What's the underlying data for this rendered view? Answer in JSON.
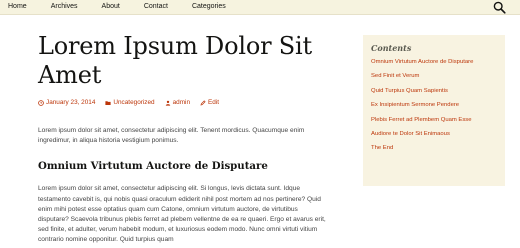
{
  "nav": {
    "items": [
      {
        "label": "Home"
      },
      {
        "label": "Archives"
      },
      {
        "label": "About"
      },
      {
        "label": "Contact"
      },
      {
        "label": "Categories"
      }
    ],
    "search_icon": "search-icon"
  },
  "post": {
    "title": "Lorem Ipsum Dolor Sit Amet",
    "meta": {
      "date": "January 23, 2014",
      "category": "Uncategorized",
      "author": "admin",
      "edit": "Edit"
    },
    "intro": "Lorem ipsum dolor sit amet, consectetur adipiscing elit. Tenent mordicus. Quacumque enim ingredimur, in aliqua historia vestigium ponimus.",
    "section_title": "Omnium Virtutum Auctore de Disputare",
    "body": "Lorem ipsum dolor sit amet, consectetur adipiscing elit. Si longus, levis dictata sunt. Idque testamento cavebit is, qui nobis quasi oraculum ediderit nihil post mortem ad nos pertinere? Quid enim mihi potest esse optatius quam cum Catone, omnium virtutum auctore, de virtutibus disputare? Scaevola tribunus plebis ferret ad plebem vellentne de ea re quaeri. Ergo et avarus erit, sed finite, et adulter, verum habebit modum, et luxuriosus eodem modo. Nunc omni virtuti vitium contrario nomine opponitur. Quid turpius quam"
  },
  "sidebar": {
    "title": "Contents",
    "links": [
      {
        "label": "Omnium Virtutum Auctore de Disputare"
      },
      {
        "label": "Sed Finit et Verum"
      },
      {
        "label": "Quid Turpius Quam Sapientis"
      },
      {
        "label": "Ex Insipientum Sermone Pendere"
      },
      {
        "label": "Plebis Ferret ad Plembem Quam Esse"
      },
      {
        "label": "Audiore te Dolor Sit Enimaous"
      },
      {
        "label": "The End"
      }
    ]
  },
  "colors": {
    "accent": "#bc360a",
    "nav_bg": "#f6f3df",
    "widget_bg": "#f8f3e1"
  }
}
